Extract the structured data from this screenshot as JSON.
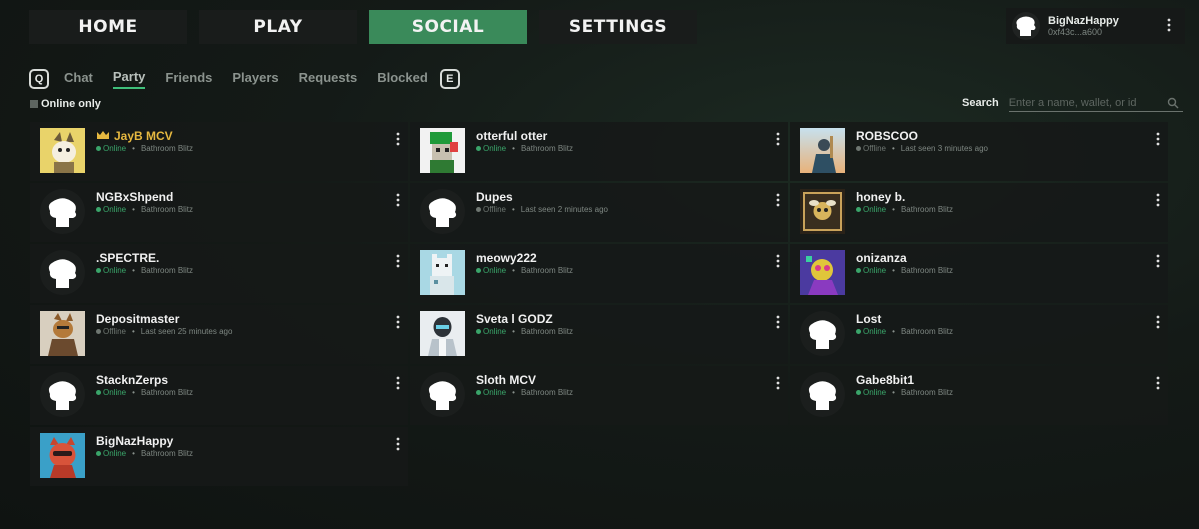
{
  "nav": {
    "tabs": [
      {
        "label": "HOME",
        "active": false
      },
      {
        "label": "PLAY",
        "active": false
      },
      {
        "label": "SOCIAL",
        "active": true
      },
      {
        "label": "SETTINGS",
        "active": false
      }
    ]
  },
  "user": {
    "name": "BigNazHappy",
    "wallet": "0xf43c...a600",
    "avatar_icon": "default-avatar-icon"
  },
  "subtabs": {
    "left_key": "Q",
    "right_key": "E",
    "items": [
      {
        "label": "Chat",
        "active": false
      },
      {
        "label": "Party",
        "active": true
      },
      {
        "label": "Friends",
        "active": false
      },
      {
        "label": "Players",
        "active": false
      },
      {
        "label": "Requests",
        "active": false
      },
      {
        "label": "Blocked",
        "active": false
      }
    ]
  },
  "filters": {
    "online_only_label": "Online only"
  },
  "search": {
    "label": "Search",
    "placeholder": "Enter a name, wallet, or id"
  },
  "colors": {
    "accent": "#3a8a5a",
    "online": "#3aa56a",
    "offline": "#6f7772",
    "leader": "#e6b840"
  },
  "members": [
    {
      "name": "JayB MCV",
      "status": "Online",
      "detail": "Bathroom Blitz",
      "online": true,
      "leader": true,
      "avatar": "yellow-creature"
    },
    {
      "name": "otterful otter",
      "status": "Online",
      "detail": "Bathroom Blitz",
      "online": true,
      "avatar": "green-otter"
    },
    {
      "name": "ROBSCOO",
      "status": "Offline",
      "detail": "Last seen 3 minutes ago",
      "online": false,
      "avatar": "sky-warrior"
    },
    {
      "name": "NGBxShpend",
      "status": "Online",
      "detail": "Bathroom Blitz",
      "online": true,
      "avatar": "default"
    },
    {
      "name": "Dupes",
      "status": "Offline",
      "detail": "Last seen 2 minutes ago",
      "online": false,
      "avatar": "default"
    },
    {
      "name": "honey b.",
      "status": "Online",
      "detail": "Bathroom Blitz",
      "online": true,
      "avatar": "dark-bee"
    },
    {
      "name": ".SPECTRE.",
      "status": "Online",
      "detail": "Bathroom Blitz",
      "online": true,
      "avatar": "default"
    },
    {
      "name": "meowy222",
      "status": "Online",
      "detail": "Bathroom Blitz",
      "online": true,
      "avatar": "pixel-cat"
    },
    {
      "name": "onizanza",
      "status": "Online",
      "detail": "Bathroom Blitz",
      "online": true,
      "avatar": "purple-psyche"
    },
    {
      "name": "Depositmaster",
      "status": "Offline",
      "detail": "Last seen 25 minutes ago",
      "online": false,
      "avatar": "brown-fox"
    },
    {
      "name": "Sveta l GODZ",
      "status": "Online",
      "detail": "Bathroom Blitz",
      "online": true,
      "avatar": "robot"
    },
    {
      "name": "Lost",
      "status": "Online",
      "detail": "Bathroom Blitz",
      "online": true,
      "avatar": "default"
    },
    {
      "name": "StacknZerps",
      "status": "Online",
      "detail": "Bathroom Blitz",
      "online": true,
      "avatar": "default"
    },
    {
      "name": "Sloth MCV",
      "status": "Online",
      "detail": "Bathroom Blitz",
      "online": true,
      "avatar": "default"
    },
    {
      "name": "Gabe8bit1",
      "status": "Online",
      "detail": "Bathroom Blitz",
      "online": true,
      "avatar": "default"
    },
    {
      "name": "BigNazHappy",
      "status": "Online",
      "detail": "Bathroom Blitz",
      "online": true,
      "avatar": "red-cat"
    }
  ]
}
